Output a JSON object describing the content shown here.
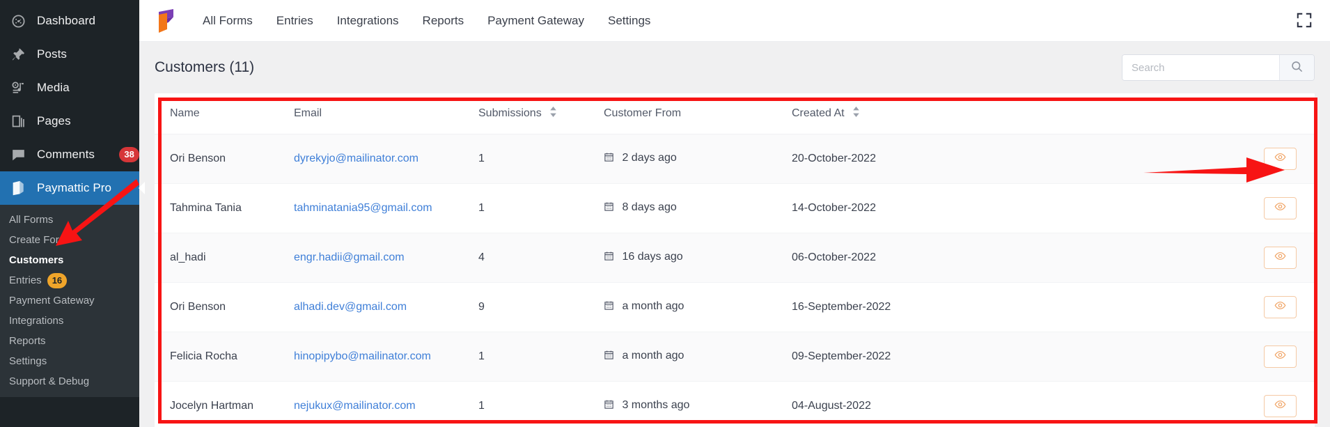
{
  "wp_sidebar": {
    "items": [
      {
        "label": "Dashboard",
        "icon": "dashboard-icon",
        "badge": null,
        "active": false
      },
      {
        "label": "Posts",
        "icon": "pin-icon",
        "badge": null,
        "active": false
      },
      {
        "label": "Media",
        "icon": "media-icon",
        "badge": null,
        "active": false
      },
      {
        "label": "Pages",
        "icon": "pages-icon",
        "badge": null,
        "active": false
      },
      {
        "label": "Comments",
        "icon": "comment-icon",
        "badge": "38",
        "badge_color": "#d63638",
        "active": false
      },
      {
        "label": "Paymattic Pro",
        "icon": "paymattic-icon",
        "badge": null,
        "active": true
      }
    ],
    "submenu": [
      {
        "label": "All Forms",
        "badge": null,
        "current": false
      },
      {
        "label": "Create Form",
        "badge": null,
        "current": false
      },
      {
        "label": "Customers",
        "badge": null,
        "current": true
      },
      {
        "label": "Entries",
        "badge": "16",
        "badge_color": "#f0a52a",
        "current": false
      },
      {
        "label": "Payment Gateway",
        "badge": null,
        "current": false
      },
      {
        "label": "Integrations",
        "badge": null,
        "current": false
      },
      {
        "label": "Reports",
        "badge": null,
        "current": false
      },
      {
        "label": "Settings",
        "badge": null,
        "current": false
      },
      {
        "label": "Support & Debug",
        "badge": null,
        "current": false
      }
    ]
  },
  "topbar": {
    "logo_icon": "paymattic-logo",
    "logo_colors": {
      "purple": "#7b3fb5",
      "orange": "#f2761a"
    },
    "nav": [
      {
        "label": "All Forms"
      },
      {
        "label": "Entries"
      },
      {
        "label": "Integrations"
      },
      {
        "label": "Reports"
      },
      {
        "label": "Payment Gateway"
      },
      {
        "label": "Settings"
      }
    ],
    "fullscreen_icon": "fullscreen-icon"
  },
  "page": {
    "title": "Customers (11)",
    "search": {
      "placeholder": "Search",
      "value": "",
      "button_icon": "search-icon"
    }
  },
  "table": {
    "columns": [
      {
        "label": "Name",
        "sortable": false
      },
      {
        "label": "Email",
        "sortable": false
      },
      {
        "label": "Submissions",
        "sortable": true
      },
      {
        "label": "Customer From",
        "sortable": false
      },
      {
        "label": "Created At",
        "sortable": true
      },
      {
        "label": "",
        "sortable": false
      }
    ],
    "rows": [
      {
        "name": "Ori Benson",
        "email": "dyrekyjo@mailinator.com",
        "submissions": "1",
        "customer_from": "2 days ago",
        "created_at": "20-October-2022",
        "action_icon": "eye-icon"
      },
      {
        "name": "Tahmina Tania",
        "email": "tahminatania95@gmail.com",
        "submissions": "1",
        "customer_from": "8 days ago",
        "created_at": "14-October-2022",
        "action_icon": "eye-icon"
      },
      {
        "name": "al_hadi",
        "email": "engr.hadii@gmail.com",
        "submissions": "4",
        "customer_from": "16 days ago",
        "created_at": "06-October-2022",
        "action_icon": "eye-icon"
      },
      {
        "name": "Ori Benson",
        "email": "alhadi.dev@gmail.com",
        "submissions": "9",
        "customer_from": "a month ago",
        "created_at": "16-September-2022",
        "action_icon": "eye-icon"
      },
      {
        "name": "Felicia Rocha",
        "email": "hinopipybo@mailinator.com",
        "submissions": "1",
        "customer_from": "a month ago",
        "created_at": "09-September-2022",
        "action_icon": "eye-icon"
      },
      {
        "name": "Jocelyn Hartman",
        "email": "nejukux@mailinator.com",
        "submissions": "1",
        "customer_from": "3 months ago",
        "created_at": "04-August-2022",
        "action_icon": "eye-icon"
      }
    ]
  },
  "annotations": {
    "color": "#f71414",
    "box_label": "customers-table-highlight",
    "arrow_to_view_button": "arrow-pointing-to-view-action",
    "arrow_to_customers_menu": "arrow-pointing-to-customers-menu"
  }
}
